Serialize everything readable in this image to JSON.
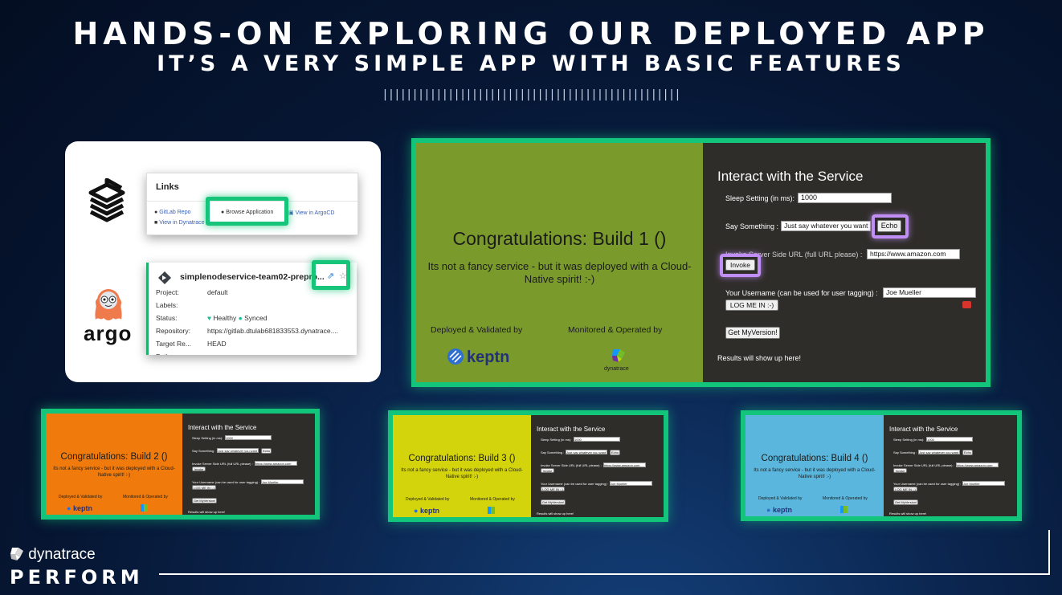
{
  "slide": {
    "title": "HANDS-ON EXPLORING OUR DEPLOYED APP",
    "subtitle": "IT’S A VERY SIMPLE APP WITH BASIC FEATURES",
    "divider": "||||||||||||||||||||||||||||||||||||||||||||||||||"
  },
  "links_card": {
    "heading": "Links",
    "items": [
      "GitLab Repo",
      "Browse Application",
      "View in ArgoCD",
      "View in Dynatrace"
    ]
  },
  "argo_logo_text": "argo",
  "argo_app": {
    "name": "simplenodeservice-team02-prepro...",
    "rows": [
      {
        "key": "Project:",
        "value": "default"
      },
      {
        "key": "Labels:",
        "value": ""
      },
      {
        "key": "Status:",
        "value": "Healthy",
        "value2": "Synced"
      },
      {
        "key": "Repository:",
        "value": "https://gitlab.dtulab681833553.dynatrace...."
      },
      {
        "key": "Target Re...",
        "value": "HEAD"
      },
      {
        "key": "Path:",
        "value": ""
      }
    ]
  },
  "service_common": {
    "heading": "Interact with the Service",
    "sleep_label": "Sleep Setting (in ms):",
    "sleep_value": "1000",
    "say_label": "Say Something :",
    "say_value": "Just say whatever you want",
    "echo_button": "Echo",
    "invoke_label": "Invoke Server Side URL (full URL please) :",
    "invoke_value": "https://www.amazon.com",
    "invoke_button": "Invoke",
    "username_label": "Your Username (can be used for user tagging) :",
    "username_value": "Joe Mueller",
    "login_button": "LOG ME IN :-)",
    "version_button": "Get MyVersion!",
    "results_text": "Results will show up here!",
    "tagline": "Its not a fancy service - but it was deployed with a Cloud-Native spirit! :-)",
    "deployed_by": "Deployed & Validated by",
    "monitored_by": "Monitored & Operated by",
    "keptn": "keptn",
    "dynatrace_small": "dynatrace"
  },
  "builds": [
    {
      "title": "Congratulations: Build 1 ()",
      "color": "#7a9a2c"
    },
    {
      "title": "Congratulations: Build 2 ()",
      "color": "#f07b0c"
    },
    {
      "title": "Congratulations: Build 3 ()",
      "color": "#d4d40c"
    },
    {
      "title": "Congratulations: Build 4 ()",
      "color": "#5ab6dc"
    }
  ],
  "footer": {
    "brand": "dynatrace",
    "event": "PERFORM"
  },
  "colors": {
    "highlight_green": "#12c57b",
    "highlight_purple": "#c08ef5",
    "service_bg": "#2f2d2a"
  }
}
